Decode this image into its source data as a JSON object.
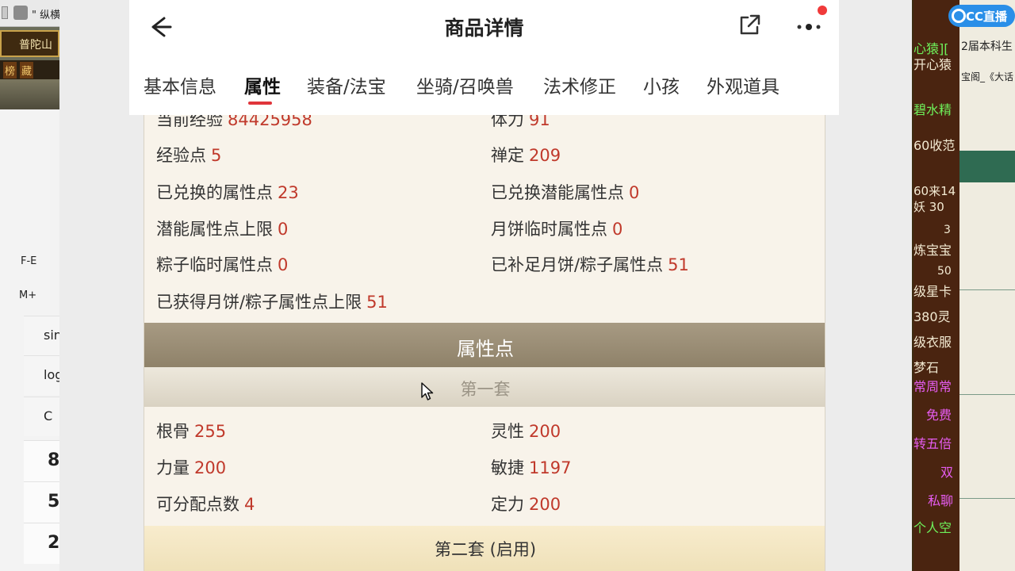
{
  "left": {
    "game_title": "\" 纵横",
    "location": "普陀山",
    "buttons": [
      "榜",
      "藏"
    ],
    "calc_keys": [
      "F-E",
      "M+",
      "sin",
      "log",
      "C"
    ],
    "calc_numbers": [
      "8",
      "5",
      "2"
    ]
  },
  "header": {
    "title": "商品详情"
  },
  "tabs": [
    {
      "label": "基本信息",
      "active": false
    },
    {
      "label": "属性",
      "active": true
    },
    {
      "label": "装备/法宝",
      "active": false
    },
    {
      "label": "坐骑/召唤兽",
      "active": false
    },
    {
      "label": "法术修正",
      "active": false
    },
    {
      "label": "小孩",
      "active": false
    },
    {
      "label": "外观道具",
      "active": false
    }
  ],
  "stats": {
    "current_exp": {
      "label": "当前经验",
      "value": "84425958"
    },
    "stamina": {
      "label": "体力",
      "value": "91"
    },
    "exp_points": {
      "label": "经验点",
      "value": "5"
    },
    "zen": {
      "label": "禅定",
      "value": "209"
    },
    "exchanged_attr": {
      "label": "已兑换的属性点",
      "value": "23"
    },
    "exchanged_potential": {
      "label": "已兑换潜能属性点",
      "value": "0"
    },
    "potential_cap": {
      "label": "潜能属性点上限",
      "value": "0"
    },
    "mooncake_temp": {
      "label": "月饼临时属性点",
      "value": "0"
    },
    "zongzi_temp": {
      "label": "粽子临时属性点",
      "value": "0"
    },
    "filled_mooncake": {
      "label": "已补足月饼/粽子属性点",
      "value": "51"
    },
    "obtained_cap": {
      "label": "已获得月饼/粽子属性点上限",
      "value": "51"
    }
  },
  "attr_section": {
    "title": "属性点",
    "set1_title": "第一套",
    "set1": {
      "constitution": {
        "label": "根骨",
        "value": "255"
      },
      "spirit": {
        "label": "灵性",
        "value": "200"
      },
      "strength": {
        "label": "力量",
        "value": "200"
      },
      "agility": {
        "label": "敏捷",
        "value": "1197"
      },
      "free_points": {
        "label": "可分配点数",
        "value": "4"
      },
      "focus": {
        "label": "定力",
        "value": "200"
      }
    },
    "set2_title": "第二套 (启用)"
  },
  "right": {
    "logo": "CC直播",
    "chat": [
      "心猿][",
      "开心猿",
      "碧水精",
      "60收范",
      "60来14",
      "妖 30",
      "3",
      "炼宝宝",
      "50",
      "级星卡",
      "380灵",
      "级衣服",
      "梦石",
      "常周常",
      "免费",
      "转五倍",
      "双",
      "私聊",
      "个人空"
    ],
    "panel": [
      "2届本科生",
      "宝阁_《大话"
    ]
  },
  "colors": {
    "value_red": "#c0392b",
    "tab_underline": "#e0353b",
    "section_header": "#978a72"
  }
}
